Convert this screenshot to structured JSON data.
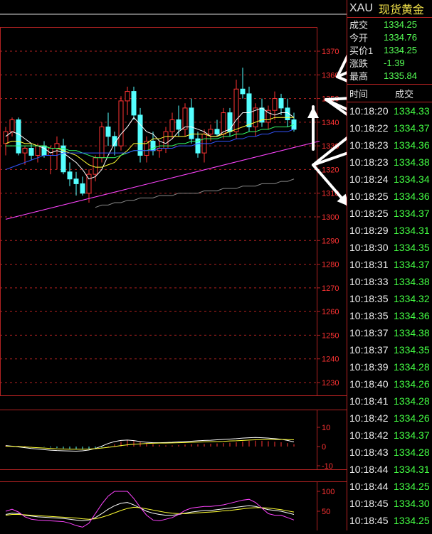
{
  "header": {
    "code": "XAU",
    "name": "现货黄金"
  },
  "quote": [
    {
      "label": "成交",
      "value": "1334.25"
    },
    {
      "label": "今开",
      "value": "1334.76"
    },
    {
      "label": "买价1",
      "value": "1334.25"
    },
    {
      "label": "涨跌",
      "value": "-1.39"
    },
    {
      "label": "最高",
      "value": "1335.84"
    }
  ],
  "ticks_header": {
    "time": "时间",
    "price": "成交"
  },
  "ticks": [
    {
      "time": "10:18:20",
      "price": "1334.33"
    },
    {
      "time": "10:18:22",
      "price": "1334.37"
    },
    {
      "time": "10:18:23",
      "price": "1334.36"
    },
    {
      "time": "10:18:23",
      "price": "1334.38"
    },
    {
      "time": "10:18:24",
      "price": "1334.34"
    },
    {
      "time": "10:18:25",
      "price": "1334.36"
    },
    {
      "time": "10:18:25",
      "price": "1334.37"
    },
    {
      "time": "10:18:29",
      "price": "1334.31"
    },
    {
      "time": "10:18:30",
      "price": "1334.35"
    },
    {
      "time": "10:18:31",
      "price": "1334.37"
    },
    {
      "time": "10:18:33",
      "price": "1334.38"
    },
    {
      "time": "10:18:35",
      "price": "1334.32"
    },
    {
      "time": "10:18:35",
      "price": "1334.36"
    },
    {
      "time": "10:18:37",
      "price": "1334.38"
    },
    {
      "time": "10:18:37",
      "price": "1334.35"
    },
    {
      "time": "10:18:39",
      "price": "1334.28"
    },
    {
      "time": "10:18:40",
      "price": "1334.26"
    },
    {
      "time": "10:18:41",
      "price": "1334.28"
    },
    {
      "time": "10:18:42",
      "price": "1334.26"
    },
    {
      "time": "10:18:42",
      "price": "1334.37"
    },
    {
      "time": "10:18:43",
      "price": "1334.28"
    },
    {
      "time": "10:18:44",
      "price": "1334.31"
    },
    {
      "time": "10:18:44",
      "price": "1334.25"
    },
    {
      "time": "10:18:45",
      "price": "1334.30"
    },
    {
      "time": "10:18:45",
      "price": "1334.25"
    }
  ],
  "colors": {
    "up": "#ff3333",
    "down": "#55ffff",
    "grid": "#b22222",
    "ma5": "#ffffff",
    "ma10": "#ffff33",
    "ma20": "#33ff66",
    "ma30": "#3355ff",
    "ma60": "#888888",
    "trend": "#ff44ff"
  },
  "chart_data": [
    {
      "type": "candlestick",
      "ylim": [
        1225,
        1375
      ],
      "yticks": [
        "1370",
        "1360",
        "1350",
        "1340",
        "1330",
        "1320",
        "1310",
        "1300",
        "1290",
        "1280",
        "1270",
        "1260",
        "1250",
        "1240",
        "1230"
      ],
      "candles": [
        {
          "o": 1331,
          "h": 1338,
          "l": 1326,
          "c": 1336
        },
        {
          "o": 1336,
          "h": 1342,
          "l": 1334,
          "c": 1341
        },
        {
          "o": 1341,
          "h": 1342,
          "l": 1326,
          "c": 1327
        },
        {
          "o": 1327,
          "h": 1330,
          "l": 1322,
          "c": 1329
        },
        {
          "o": 1329,
          "h": 1331,
          "l": 1324,
          "c": 1326
        },
        {
          "o": 1326,
          "h": 1331,
          "l": 1323,
          "c": 1330
        },
        {
          "o": 1330,
          "h": 1332,
          "l": 1325,
          "c": 1326
        },
        {
          "o": 1326,
          "h": 1330,
          "l": 1318,
          "c": 1329
        },
        {
          "o": 1329,
          "h": 1334,
          "l": 1320,
          "c": 1331
        },
        {
          "o": 1330,
          "h": 1333,
          "l": 1318,
          "c": 1319
        },
        {
          "o": 1319,
          "h": 1323,
          "l": 1313,
          "c": 1316
        },
        {
          "o": 1316,
          "h": 1319,
          "l": 1309,
          "c": 1314
        },
        {
          "o": 1314,
          "h": 1317,
          "l": 1309,
          "c": 1310
        },
        {
          "o": 1310,
          "h": 1320,
          "l": 1306,
          "c": 1318
        },
        {
          "o": 1318,
          "h": 1326,
          "l": 1315,
          "c": 1325
        },
        {
          "o": 1325,
          "h": 1340,
          "l": 1323,
          "c": 1338
        },
        {
          "o": 1338,
          "h": 1344,
          "l": 1330,
          "c": 1334
        },
        {
          "o": 1334,
          "h": 1336,
          "l": 1326,
          "c": 1330
        },
        {
          "o": 1330,
          "h": 1351,
          "l": 1328,
          "c": 1349
        },
        {
          "o": 1349,
          "h": 1355,
          "l": 1343,
          "c": 1353
        },
        {
          "o": 1353,
          "h": 1355,
          "l": 1341,
          "c": 1343
        },
        {
          "o": 1343,
          "h": 1346,
          "l": 1323,
          "c": 1326
        },
        {
          "o": 1326,
          "h": 1334,
          "l": 1323,
          "c": 1332
        },
        {
          "o": 1332,
          "h": 1336,
          "l": 1326,
          "c": 1328
        },
        {
          "o": 1328,
          "h": 1332,
          "l": 1325,
          "c": 1329
        },
        {
          "o": 1329,
          "h": 1338,
          "l": 1327,
          "c": 1336
        },
        {
          "o": 1336,
          "h": 1344,
          "l": 1333,
          "c": 1341
        },
        {
          "o": 1341,
          "h": 1347,
          "l": 1334,
          "c": 1337
        },
        {
          "o": 1337,
          "h": 1348,
          "l": 1334,
          "c": 1346
        },
        {
          "o": 1346,
          "h": 1350,
          "l": 1331,
          "c": 1333
        },
        {
          "o": 1333,
          "h": 1336,
          "l": 1325,
          "c": 1327
        },
        {
          "o": 1327,
          "h": 1337,
          "l": 1323,
          "c": 1335
        },
        {
          "o": 1335,
          "h": 1339,
          "l": 1332,
          "c": 1337
        },
        {
          "o": 1337,
          "h": 1341,
          "l": 1334,
          "c": 1335
        },
        {
          "o": 1335,
          "h": 1346,
          "l": 1333,
          "c": 1344
        },
        {
          "o": 1344,
          "h": 1346,
          "l": 1334,
          "c": 1336
        },
        {
          "o": 1336,
          "h": 1358,
          "l": 1333,
          "c": 1354
        },
        {
          "o": 1354,
          "h": 1363,
          "l": 1350,
          "c": 1352
        },
        {
          "o": 1352,
          "h": 1355,
          "l": 1336,
          "c": 1338
        },
        {
          "o": 1338,
          "h": 1348,
          "l": 1334,
          "c": 1346
        },
        {
          "o": 1346,
          "h": 1350,
          "l": 1338,
          "c": 1340
        },
        {
          "o": 1340,
          "h": 1347,
          "l": 1337,
          "c": 1345
        },
        {
          "o": 1345,
          "h": 1353,
          "l": 1341,
          "c": 1350
        },
        {
          "o": 1350,
          "h": 1352,
          "l": 1343,
          "c": 1346
        },
        {
          "o": 1346,
          "h": 1350,
          "l": 1338,
          "c": 1341
        },
        {
          "o": 1341,
          "h": 1344,
          "l": 1336,
          "c": 1337
        }
      ],
      "ma_lines": [
        {
          "name": "MA5",
          "color": "#ffffff",
          "values": [
            1334,
            1336,
            1335,
            1333,
            1331,
            1330,
            1329,
            1327,
            1328,
            1327,
            1325,
            1323,
            1320,
            1316,
            1317,
            1320,
            1326,
            1331,
            1335,
            1338,
            1342,
            1339,
            1336,
            1335,
            1332,
            1331,
            1333,
            1336,
            1338,
            1338,
            1337,
            1336,
            1334,
            1334,
            1336,
            1337,
            1341,
            1344,
            1344,
            1345,
            1346,
            1344,
            1343,
            1344,
            1344,
            1342
          ]
        },
        {
          "name": "MA10",
          "color": "#ffff33",
          "values": [
            1331,
            1332,
            1332,
            1331,
            1331,
            1330,
            1330,
            1329,
            1329,
            1328,
            1327,
            1326,
            1324,
            1322,
            1321,
            1321,
            1322,
            1323,
            1326,
            1328,
            1331,
            1331,
            1331,
            1333,
            1333,
            1334,
            1334,
            1334,
            1334,
            1335,
            1335,
            1335,
            1334,
            1334,
            1335,
            1336,
            1337,
            1338,
            1339,
            1340,
            1341,
            1341,
            1342,
            1342,
            1342,
            1342
          ]
        },
        {
          "name": "MA20",
          "color": "#33ff66",
          "values": [
            1330,
            1330,
            1330,
            1330,
            1330,
            1330,
            1330,
            1329,
            1329,
            1329,
            1328,
            1328,
            1327,
            1326,
            1325,
            1325,
            1325,
            1325,
            1326,
            1327,
            1328,
            1328,
            1328,
            1329,
            1330,
            1330,
            1330,
            1331,
            1331,
            1332,
            1332,
            1333,
            1333,
            1333,
            1334,
            1334,
            1335,
            1335,
            1336,
            1336,
            1337,
            1337,
            1338,
            1338,
            1338,
            1339
          ]
        },
        {
          "name": "MA30",
          "color": "#3355ff",
          "values": [
            1320,
            1321,
            1322,
            1323,
            1324,
            1325,
            1326,
            1326,
            1326,
            1327,
            1327,
            1327,
            1327,
            1327,
            1327,
            1327,
            1327,
            1327,
            1327,
            1327,
            1328,
            1328,
            1328,
            1328,
            1329,
            1329,
            1329,
            1330,
            1330,
            1330,
            1331,
            1331,
            1331,
            1332,
            1332,
            1332,
            1333,
            1333,
            1334,
            1334,
            1335,
            1335,
            1336,
            1336,
            1336,
            1337
          ]
        },
        {
          "name": "MA60",
          "color": "#888888",
          "values": [
            null,
            null,
            null,
            null,
            null,
            null,
            null,
            null,
            null,
            null,
            null,
            null,
            null,
            null,
            1304,
            1305,
            1305,
            1306,
            1306,
            1307,
            1307,
            1308,
            1308,
            1308,
            1309,
            1309,
            1309,
            1310,
            1310,
            1310,
            1310,
            1311,
            1311,
            1311,
            1312,
            1312,
            1312,
            1313,
            1313,
            1313,
            1314,
            1314,
            1314,
            1315,
            1315,
            1316
          ]
        }
      ],
      "trendline": [
        [
          0,
          1299
        ],
        [
          49,
          1332
        ]
      ]
    },
    {
      "type": "bar",
      "ylim": [
        -10,
        15
      ],
      "yticks": [
        "10",
        "0",
        "-10"
      ],
      "values": [
        0.5,
        0.4,
        0.3,
        0.2,
        0.1,
        0,
        -0.2,
        -0.5,
        -0.8,
        -1,
        -1.2,
        -1.5,
        -1.6,
        -1.4,
        -1,
        -0.5,
        0.3,
        1.2,
        2.5,
        3.2,
        3,
        2.5,
        1.8,
        1.2,
        0.8,
        0.6,
        0.6,
        0.8,
        1,
        1.2,
        1.2,
        1.3,
        1.5,
        1.6,
        1.8,
        2,
        2.2,
        2.6,
        3,
        3.1,
        3,
        2.8,
        2.5,
        2.2,
        1.8,
        1.2
      ],
      "lines": [
        {
          "name": "DIF",
          "color": "#ffffff",
          "values": [
            0.5,
            0.2,
            -0.2,
            -0.6,
            -1,
            -1.3,
            -1.6,
            -1.9,
            -2.1,
            -2.2,
            -2.3,
            -2.4,
            -2.2,
            -1.8,
            -1,
            0.2,
            1.6,
            2.6,
            3.2,
            3.4,
            3.1,
            2.6,
            2.2,
            2,
            2,
            2.1,
            2.2,
            2.4,
            2.6,
            2.8,
            3,
            3.2,
            3.3,
            3.5,
            3.7,
            3.9,
            4.1,
            4.4,
            4.6,
            4.7,
            4.6,
            4.4,
            4.1,
            3.8,
            3.2,
            2.4
          ]
        },
        {
          "name": "DEA",
          "color": "#ffff33",
          "values": [
            0.2,
            0.1,
            0,
            -0.2,
            -0.4,
            -0.6,
            -0.8,
            -1,
            -1.2,
            -1.3,
            -1.4,
            -1.4,
            -1.4,
            -1.3,
            -1.1,
            -0.8,
            -0.4,
            0,
            0.5,
            0.9,
            1.2,
            1.4,
            1.6,
            1.7,
            1.8,
            1.8,
            1.9,
            2,
            2.1,
            2.2,
            2.3,
            2.4,
            2.5,
            2.6,
            2.7,
            2.9,
            3,
            3.2,
            3.4,
            3.5,
            3.6,
            3.7,
            3.7,
            3.7,
            3.6,
            3.5
          ]
        }
      ]
    },
    {
      "type": "line",
      "ylim": [
        0,
        110
      ],
      "yticks": [
        "100",
        "50"
      ],
      "series": [
        {
          "name": "K",
          "color": "#ffffff",
          "values": [
            42,
            45,
            44,
            40,
            38,
            36,
            35,
            34,
            33,
            32,
            30,
            28,
            26,
            28,
            34,
            44,
            55,
            64,
            70,
            72,
            66,
            58,
            50,
            45,
            42,
            40,
            40,
            42,
            45,
            48,
            50,
            52,
            52,
            54,
            56,
            58,
            60,
            62,
            64,
            62,
            58,
            54,
            52,
            50,
            46,
            42
          ]
        },
        {
          "name": "D",
          "color": "#ffff33",
          "values": [
            40,
            42,
            42,
            41,
            40,
            39,
            38,
            37,
            36,
            35,
            34,
            33,
            31,
            30,
            31,
            35,
            40,
            46,
            52,
            57,
            60,
            59,
            56,
            53,
            50,
            47,
            45,
            44,
            44,
            45,
            46,
            47,
            48,
            49,
            51,
            52,
            54,
            56,
            58,
            59,
            59,
            58,
            56,
            54,
            51,
            48
          ]
        },
        {
          "name": "J",
          "color": "#ff44ff",
          "values": [
            50,
            55,
            48,
            36,
            30,
            28,
            27,
            26,
            25,
            24,
            20,
            14,
            10,
            20,
            44,
            68,
            88,
            100,
            100,
            100,
            82,
            60,
            40,
            28,
            26,
            30,
            34,
            42,
            52,
            58,
            60,
            62,
            62,
            64,
            66,
            70,
            74,
            78,
            80,
            72,
            58,
            44,
            40,
            40,
            34,
            28
          ]
        }
      ]
    }
  ]
}
